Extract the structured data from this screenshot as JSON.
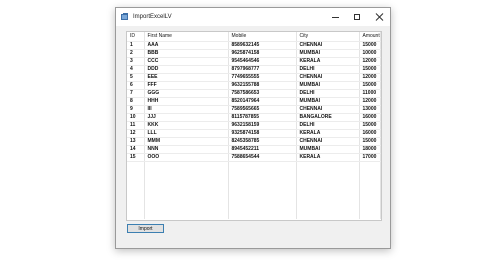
{
  "window": {
    "title": "ImportExcelLV"
  },
  "grid": {
    "columns": [
      "ID",
      "First Name",
      "Mobile",
      "City",
      "Amount"
    ],
    "rows": [
      [
        "1",
        "AAA",
        "8589632145",
        "CHENNAI",
        "15000"
      ],
      [
        "2",
        "BBB",
        "9625874158",
        "MUMBAI",
        "10000"
      ],
      [
        "3",
        "CCC",
        "9545464546",
        "KERALA",
        "12000"
      ],
      [
        "4",
        "DDD",
        "8797968777",
        "DELHI",
        "15000"
      ],
      [
        "5",
        "EEE",
        "7749655555",
        "CHENNAI",
        "12000"
      ],
      [
        "6",
        "FFF",
        "9632155788",
        "MUMBAI",
        "15000"
      ],
      [
        "7",
        "GGG",
        "7587586653",
        "DELHI",
        "11000"
      ],
      [
        "8",
        "HHH",
        "8520147964",
        "MUMBAI",
        "12000"
      ],
      [
        "9",
        "III",
        "7589565665",
        "CHENNAI",
        "13000"
      ],
      [
        "10",
        "JJJ",
        "8115787855",
        "BANGALORE",
        "16000"
      ],
      [
        "11",
        "KKK",
        "9632158159",
        "DELHI",
        "15000"
      ],
      [
        "12",
        "LLL",
        "9325874158",
        "KERALA",
        "16000"
      ],
      [
        "13",
        "MMM",
        "8245358785",
        "CHENNAI",
        "15000"
      ],
      [
        "14",
        "NNN",
        "8945452211",
        "MUMBAI",
        "18000"
      ],
      [
        "15",
        "OOO",
        "7588654544",
        "KERALA",
        "17000"
      ]
    ]
  },
  "actions": {
    "import_label": "Import"
  }
}
